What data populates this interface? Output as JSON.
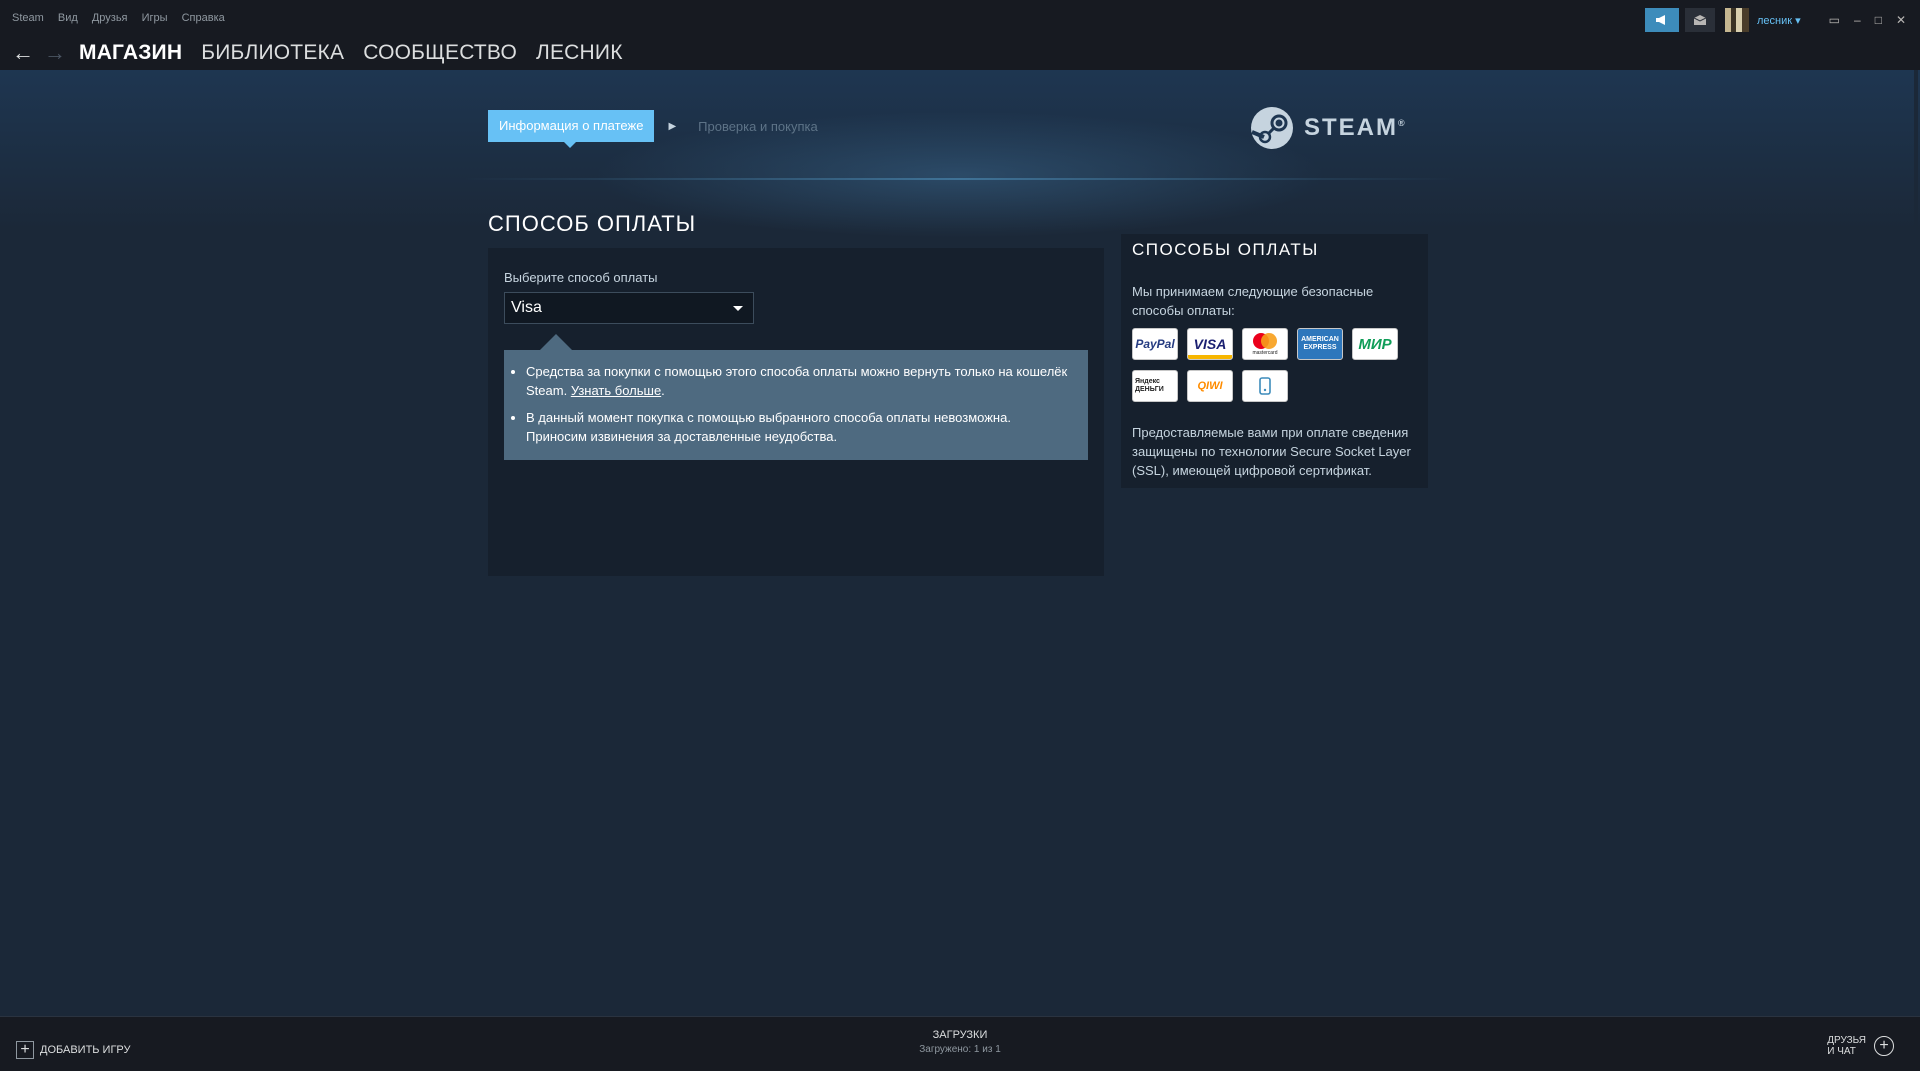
{
  "menu": [
    "Steam",
    "Вид",
    "Друзья",
    "Игры",
    "Справка"
  ],
  "user": {
    "name": "лесник"
  },
  "nav": {
    "items": [
      "МАГАЗИН",
      "БИБЛИОТЕКА",
      "СООБЩЕСТВО",
      "ЛЕСНИК"
    ],
    "active_index": 0
  },
  "steps": {
    "active": "Информация о платеже",
    "next": "Проверка и покупка"
  },
  "logo": {
    "word": "STEAM",
    "reg": "®"
  },
  "page_title": "СПОСОБ ОПЛАТЫ",
  "payment": {
    "label": "Выберите способ оплаты",
    "selected": "Visa",
    "notice_1": "Средства за покупки с помощью этого способа оплаты можно вернуть только на кошелёк Steam.",
    "notice_1_link": "Узнать больше",
    "notice_2": "В данный момент покупка с помощью выбранного способа оплаты невозможна. Приносим извинения за доставленные неудобства."
  },
  "methods": {
    "title": "СПОСОБЫ ОПЛАТЫ",
    "intro": "Мы принимаем следующие безопасные способы оплаты:",
    "cards": [
      {
        "name": "PayPal",
        "label": "PayPal",
        "color": "#253b80"
      },
      {
        "name": "Visa",
        "label": "VISA",
        "color": "#1a1f71"
      },
      {
        "name": "Mastercard",
        "label": "mastercard",
        "color": "#eb001b"
      },
      {
        "name": "American Express",
        "label": "AMERICAN EXPRESS",
        "color": "#2e77bc"
      },
      {
        "name": "МИР",
        "label": "МИР",
        "color": "#0f9d58"
      },
      {
        "name": "Яндекс Деньги",
        "label": "Яндекс ДЕНЬГИ",
        "color": "#222222"
      },
      {
        "name": "QIWI",
        "label": "QIWI",
        "color": "#ff8c00"
      },
      {
        "name": "Mobile",
        "label": "mobile-payment-icon",
        "color": "#3d8cbb"
      }
    ],
    "note": "Предоставляемые вами при оплате сведения защищены по технологии Secure Socket Layer (SSL), имеющей цифровой сертификат."
  },
  "bottom": {
    "add_game": "ДОБАВИТЬ ИГРУ",
    "downloads": "ЗАГРУЗКИ",
    "downloads_status": "Загружено: 1 из 1",
    "friends_line1": "ДРУЗЬЯ",
    "friends_line2": "И ЧАТ"
  }
}
